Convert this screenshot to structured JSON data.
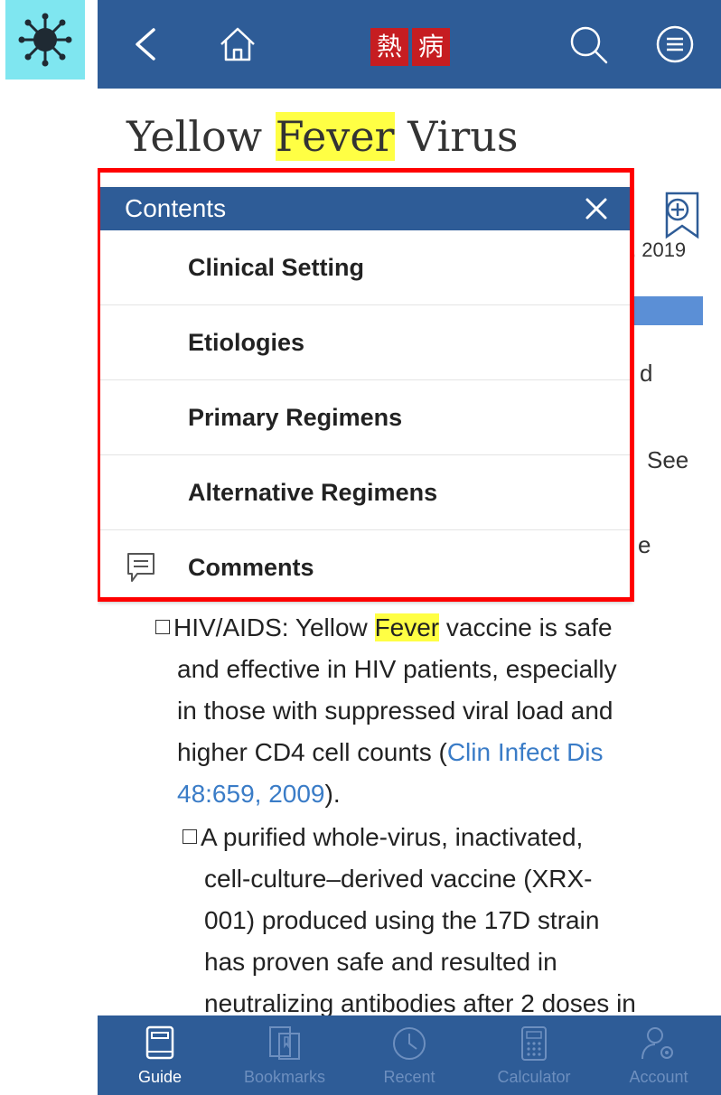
{
  "header": {
    "logo_chars": [
      "熱",
      "病"
    ]
  },
  "page": {
    "title_part1": "Yellow ",
    "title_highlight": "Fever",
    "title_part2": " Virus",
    "date_fragment": ", 2019"
  },
  "under_fragments": [
    "d",
    "See",
    "e"
  ],
  "contents_popup": {
    "title": "Contents",
    "items": [
      {
        "label": "Clinical Setting"
      },
      {
        "label": "Etiologies"
      },
      {
        "label": "Primary Regimens"
      },
      {
        "label": "Alternative Regimens"
      },
      {
        "label": "Comments"
      }
    ]
  },
  "body": {
    "para1_prefix": "HIV/AIDS: Yellow ",
    "para1_highlight": "Fever",
    "para1_line1_rest": " vaccine is safe",
    "para1_line2": "and effective in HIV patients, especially",
    "para1_line3": "in those with suppressed viral load and",
    "para1_line4_text": "higher CD4 cell counts (",
    "para1_link_a": "Clin Infect Dis",
    "para1_link_b": "48:659, 2009",
    "para1_end": ").",
    "para2_lines": [
      "A purified whole-virus, inactivated,",
      "cell-culture–derived vaccine (XRX-",
      "001) produced using the 17D strain",
      "has proven safe and resulted in",
      "neutralizing antibodies after 2 doses in"
    ]
  },
  "tabbar": {
    "tabs": [
      {
        "label": "Guide",
        "active": true
      },
      {
        "label": "Bookmarks",
        "active": false
      },
      {
        "label": "Recent",
        "active": false
      },
      {
        "label": "Calculator",
        "active": false
      },
      {
        "label": "Account",
        "active": false
      }
    ]
  },
  "colors": {
    "header_blue": "#2e5c97",
    "highlight": "#ffff44",
    "link": "#3a7cc7",
    "annotation_outline": "#ff0000"
  }
}
